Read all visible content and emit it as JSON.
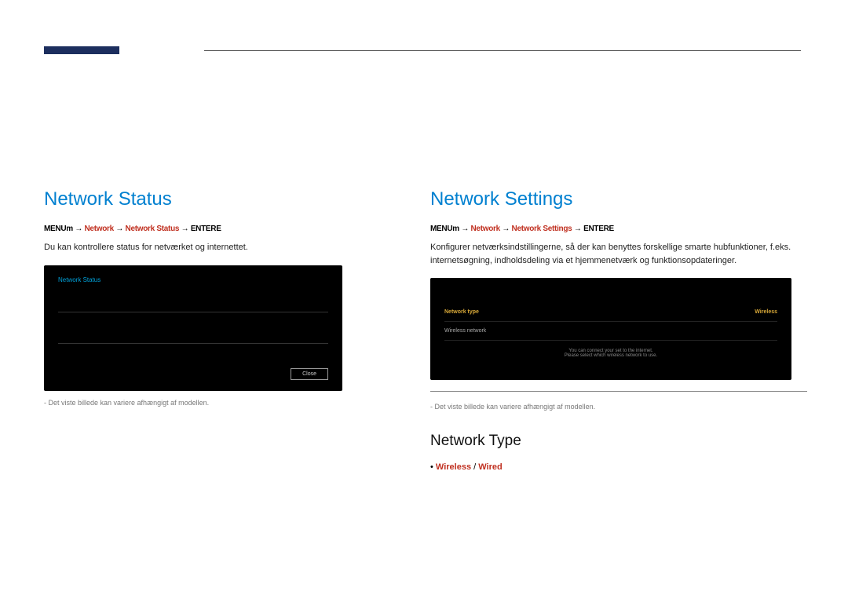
{
  "leftSection": {
    "title": "Network Status",
    "menuLabel": "MENU",
    "icon": "m",
    "net1": "Network",
    "net2": "Network Status",
    "enterLabel": "ENTER",
    "enterIcon": "E",
    "desc": "Du kan kontrollere status for netværket og internettet.",
    "panelTitle": "Network Status",
    "closeLabel": "Close",
    "disclaimer": "-  Det viste billede kan variere afhængigt af modellen."
  },
  "rightSection": {
    "title": "Network Settings",
    "menuLabel": "MENU",
    "icon": "m",
    "net1": "Network",
    "net2": "Network Settings",
    "enterLabel": "ENTER",
    "enterIcon": "E",
    "desc": "Konfigurer netværksindstillingerne, så der kan benyttes forskellige smarte hubfunktioner, f.eks. internetsøgning, indholdsdeling via et hjemmenetværk og funktionsopdateringer.",
    "panelRow1Label": "Network type",
    "panelRow1Value": "Wireless",
    "panelRow2Label": "Wireless network",
    "panelRow2Value": "",
    "panelNote": "You can connect your set to the internet.\nPlease select which wireless network to use.",
    "disclaimer": "-  Det viste billede kan variere afhængigt af modellen.",
    "subtitle": "Network Type",
    "bullet": "•",
    "opt1": "Wireless",
    "slash": " / ",
    "opt2": "Wired"
  }
}
